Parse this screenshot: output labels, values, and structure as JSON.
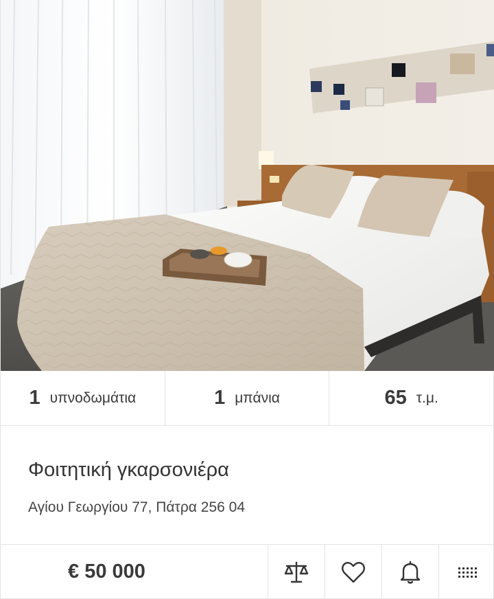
{
  "listing": {
    "photo_icon": "bedroom-photo",
    "stats": {
      "bedrooms": {
        "value": "1",
        "unit": "υπνοδωμάτια"
      },
      "bathrooms": {
        "value": "1",
        "unit": "μπάνια"
      },
      "area": {
        "value": "65",
        "unit": "τ.μ."
      }
    },
    "title": "Φοιτητική γκαρσονιέρα",
    "address": "Αγίου Γεωργίου 77,  Πάτρα 256 04",
    "price": "€ 50 000"
  },
  "actions": {
    "compare_icon": "scale-icon",
    "favorite_icon": "heart-icon",
    "alert_icon": "bell-icon",
    "more_icon": "grid-dots-icon"
  },
  "colors": {
    "text": "#3a3a3a",
    "border": "#e4e4e4",
    "icon": "#333333"
  }
}
